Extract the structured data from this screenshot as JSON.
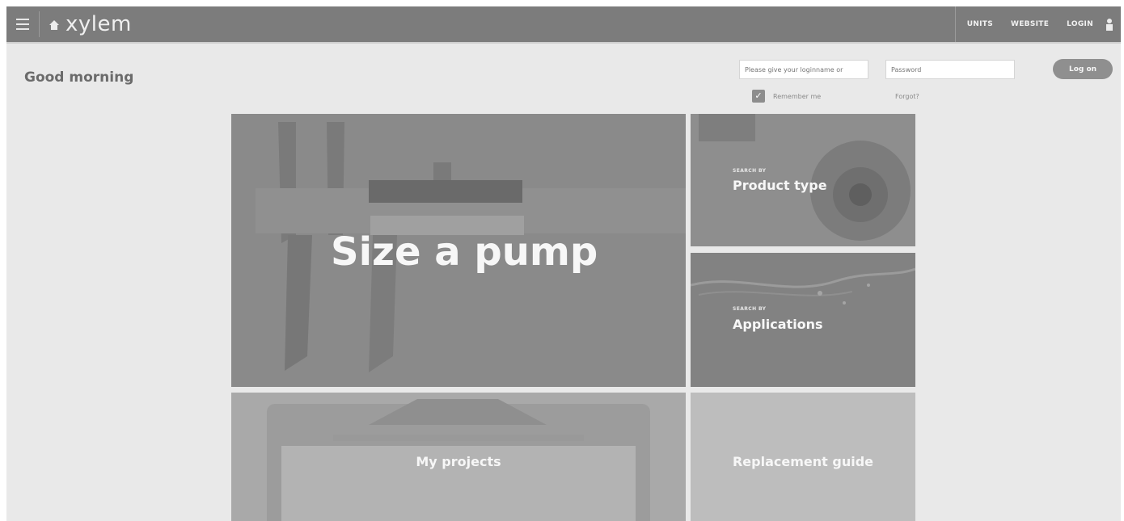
{
  "header": {
    "logo": "xylem",
    "nav": [
      "UNITS",
      "WEBSITE",
      "LOGIN"
    ]
  },
  "greeting": "Good morning",
  "login": {
    "username_placeholder": "Please give your loginname or",
    "password_placeholder": "Password",
    "submit_label": "Log on",
    "remember_label": "Remember me",
    "forgot_label": "Forgot?"
  },
  "tiles": {
    "size_pump": "Size a pump",
    "product_type": {
      "eyebrow": "SEARCH BY",
      "title": "Product type"
    },
    "applications": {
      "eyebrow": "SEARCH BY",
      "title": "Applications"
    },
    "my_projects": "My projects",
    "replacement_guide": "Replacement guide"
  },
  "icons": [
    "menu-icon",
    "home-icon",
    "user-icon",
    "checkmark-icon"
  ]
}
